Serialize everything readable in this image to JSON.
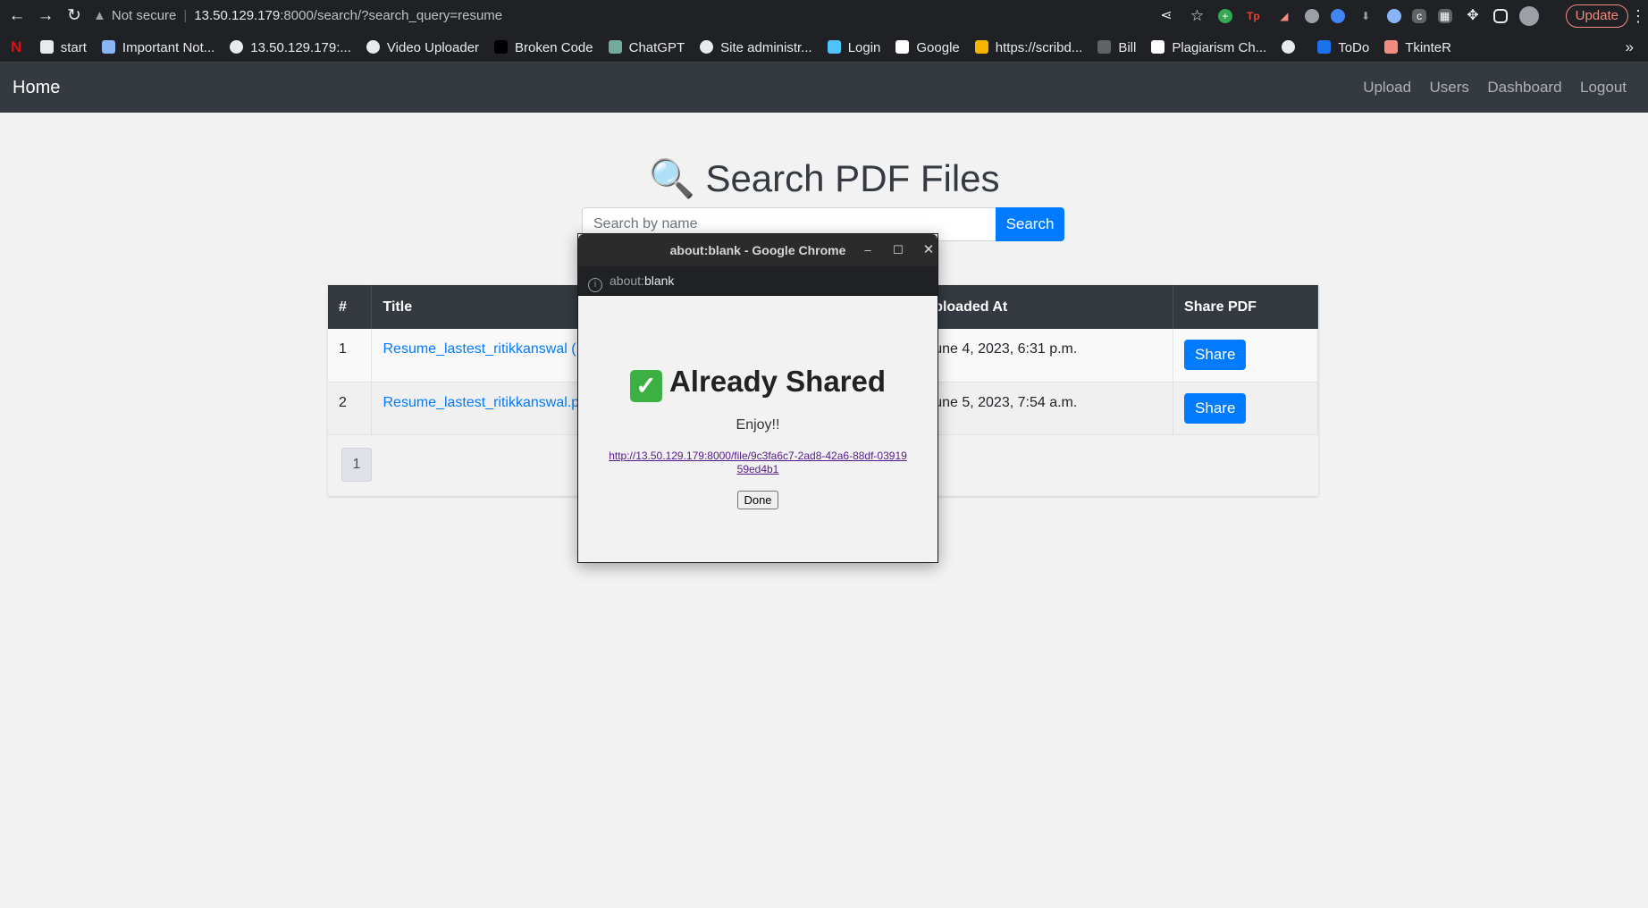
{
  "browser": {
    "omnibox": {
      "security": "Not secure",
      "host": "13.50.129.179",
      "rest": ":8000/search/?search_query=resume"
    },
    "update_label": "Update",
    "bookmarks": [
      {
        "label": "start",
        "icon": "folder-icon",
        "color": "#e8eaed"
      },
      {
        "label": "Important Not...",
        "icon": "doc-icon",
        "color": "#8ab4f8"
      },
      {
        "label": "13.50.129.179:...",
        "icon": "globe-icon",
        "color": "#e8eaed"
      },
      {
        "label": "Video Uploader",
        "icon": "globe-icon",
        "color": "#e8eaed"
      },
      {
        "label": "Broken Code",
        "icon": "b-icon",
        "color": "#000000"
      },
      {
        "label": "ChatGPT",
        "icon": "chatgpt-icon",
        "color": "#74aa9c"
      },
      {
        "label": "Site administr...",
        "icon": "globe-icon",
        "color": "#e8eaed"
      },
      {
        "label": "Login",
        "icon": "arrow-icon",
        "color": "#4fc3f7"
      },
      {
        "label": "Google",
        "icon": "google-icon",
        "color": "#ffffff"
      },
      {
        "label": "https://scribd...",
        "icon": "scribd-icon",
        "color": "#f4b400"
      },
      {
        "label": "Bill",
        "icon": "bill-icon",
        "color": "#5f6368"
      },
      {
        "label": "Plagiarism Ch...",
        "icon": "sst-icon",
        "color": "#ffffff"
      },
      {
        "label": "",
        "icon": "globe-icon",
        "color": "#e8eaed"
      },
      {
        "label": "ToDo",
        "icon": "todo-icon",
        "color": "#1a73e8"
      },
      {
        "label": "TkinteR",
        "icon": "tk-icon",
        "color": "#f28b82"
      }
    ]
  },
  "site": {
    "brand": "Home",
    "nav": [
      "Upload",
      "Users",
      "Dashboard",
      "Logout"
    ],
    "title_icon": "🔍",
    "title": "Search PDF Files",
    "search": {
      "placeholder": "Search by name",
      "button": "Search"
    },
    "table": {
      "headers": [
        "#",
        "Title",
        "Uploaded At",
        "Share PDF"
      ],
      "rows": [
        {
          "num": "1",
          "title": "Resume_lastest_ritikkanswal (",
          "uploaded": "une 4, 2023, 6:31 p.m.",
          "share": "Share"
        },
        {
          "num": "2",
          "title": "Resume_lastest_ritikkanswal.p",
          "uploaded": "une 5, 2023, 7:54 a.m.",
          "share": "Share"
        }
      ],
      "headers_visible": {
        "uploaded": "ploaded At"
      }
    },
    "pagination": "1"
  },
  "popup": {
    "window_title": "about:blank - Google Chrome",
    "url_prefix": "about:",
    "url_rest": "blank",
    "heading": "Already Shared",
    "check_glyph": "✓",
    "message": "Enjoy!!",
    "link": "http://13.50.129.179:8000/file/9c3fa6c7-2ad8-42a6-88df-0391959ed4b1",
    "done": "Done"
  }
}
